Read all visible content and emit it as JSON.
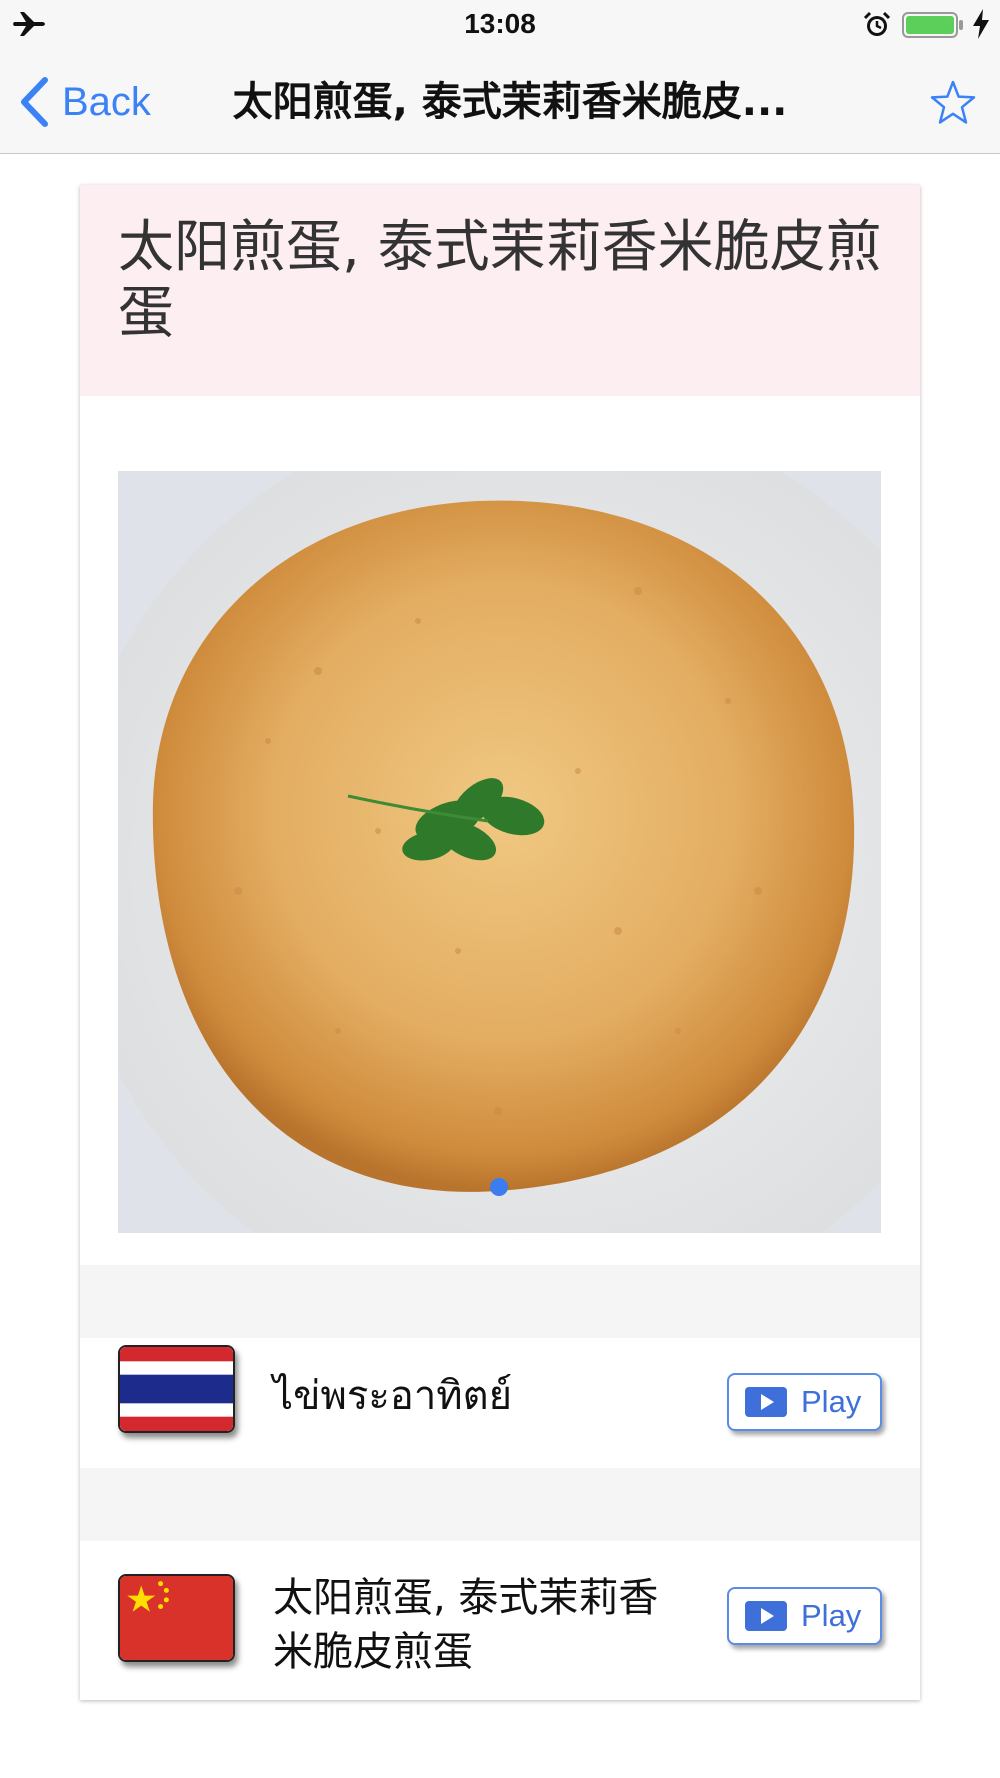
{
  "status_bar": {
    "time": "13:08",
    "icons": [
      "airplane-icon",
      "alarm-icon",
      "battery-icon",
      "charging-bolt-icon"
    ],
    "battery_color": "#5ccf5a"
  },
  "nav": {
    "back_label": "Back",
    "title": "太阳煎蛋, 泰式茉莉香米脆皮...",
    "accent_color": "#3b82f6"
  },
  "dish": {
    "title": "太阳煎蛋, 泰式茉莉香米脆皮煎蛋",
    "header_color": "#fdeef2",
    "photo_page": 1,
    "photo_pages": 1
  },
  "languages": [
    {
      "flag": "thailand-flag",
      "name": "ไข่พระอาทิตย์",
      "play_label": "Play"
    },
    {
      "flag": "china-flag",
      "name": "太阳煎蛋, 泰式茉莉香米脆皮煎蛋",
      "play_label": "Play"
    }
  ]
}
